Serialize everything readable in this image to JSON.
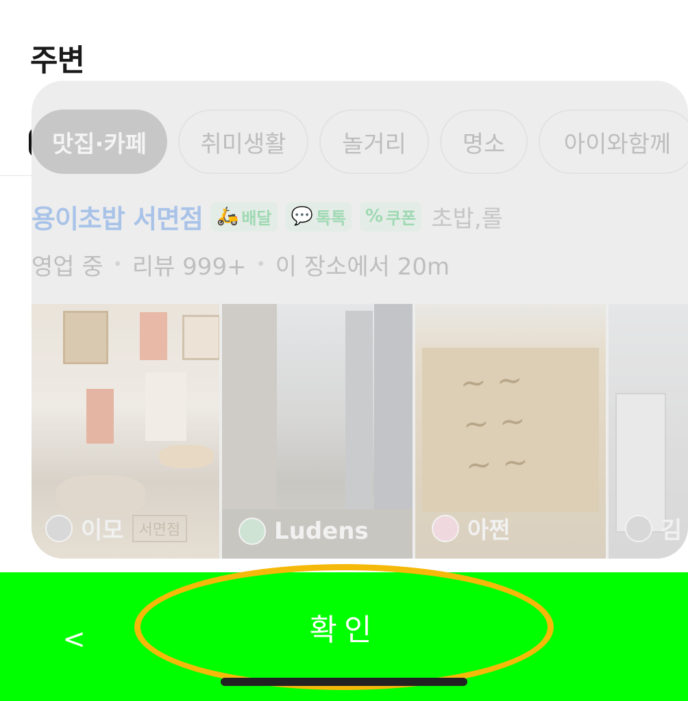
{
  "section_title": "주변",
  "chips": [
    {
      "label": "맛집·카페",
      "active": true
    },
    {
      "label": "취미생활",
      "active": false
    },
    {
      "label": "놀거리",
      "active": false
    },
    {
      "label": "명소",
      "active": false
    },
    {
      "label": "아이와함께",
      "active": false
    }
  ],
  "place": {
    "name": "용이초밥 서면점",
    "badges": {
      "delivery": "배달",
      "talk": "톡톡",
      "coupon": "쿠폰"
    },
    "category": "초밥,롤",
    "status": "영업 중",
    "reviews": "리뷰 999+",
    "distance": "이 장소에서 20m"
  },
  "photos": [
    {
      "uploader": "이모",
      "caption": "서면점"
    },
    {
      "uploader": "Ludens"
    },
    {
      "uploader": "아쩐"
    },
    {
      "uploader": "김"
    }
  ],
  "bottom_bar": {
    "back_label": "<",
    "confirm_label": "확인",
    "background": "#00ff00",
    "highlight_color": "#f5b90a"
  }
}
